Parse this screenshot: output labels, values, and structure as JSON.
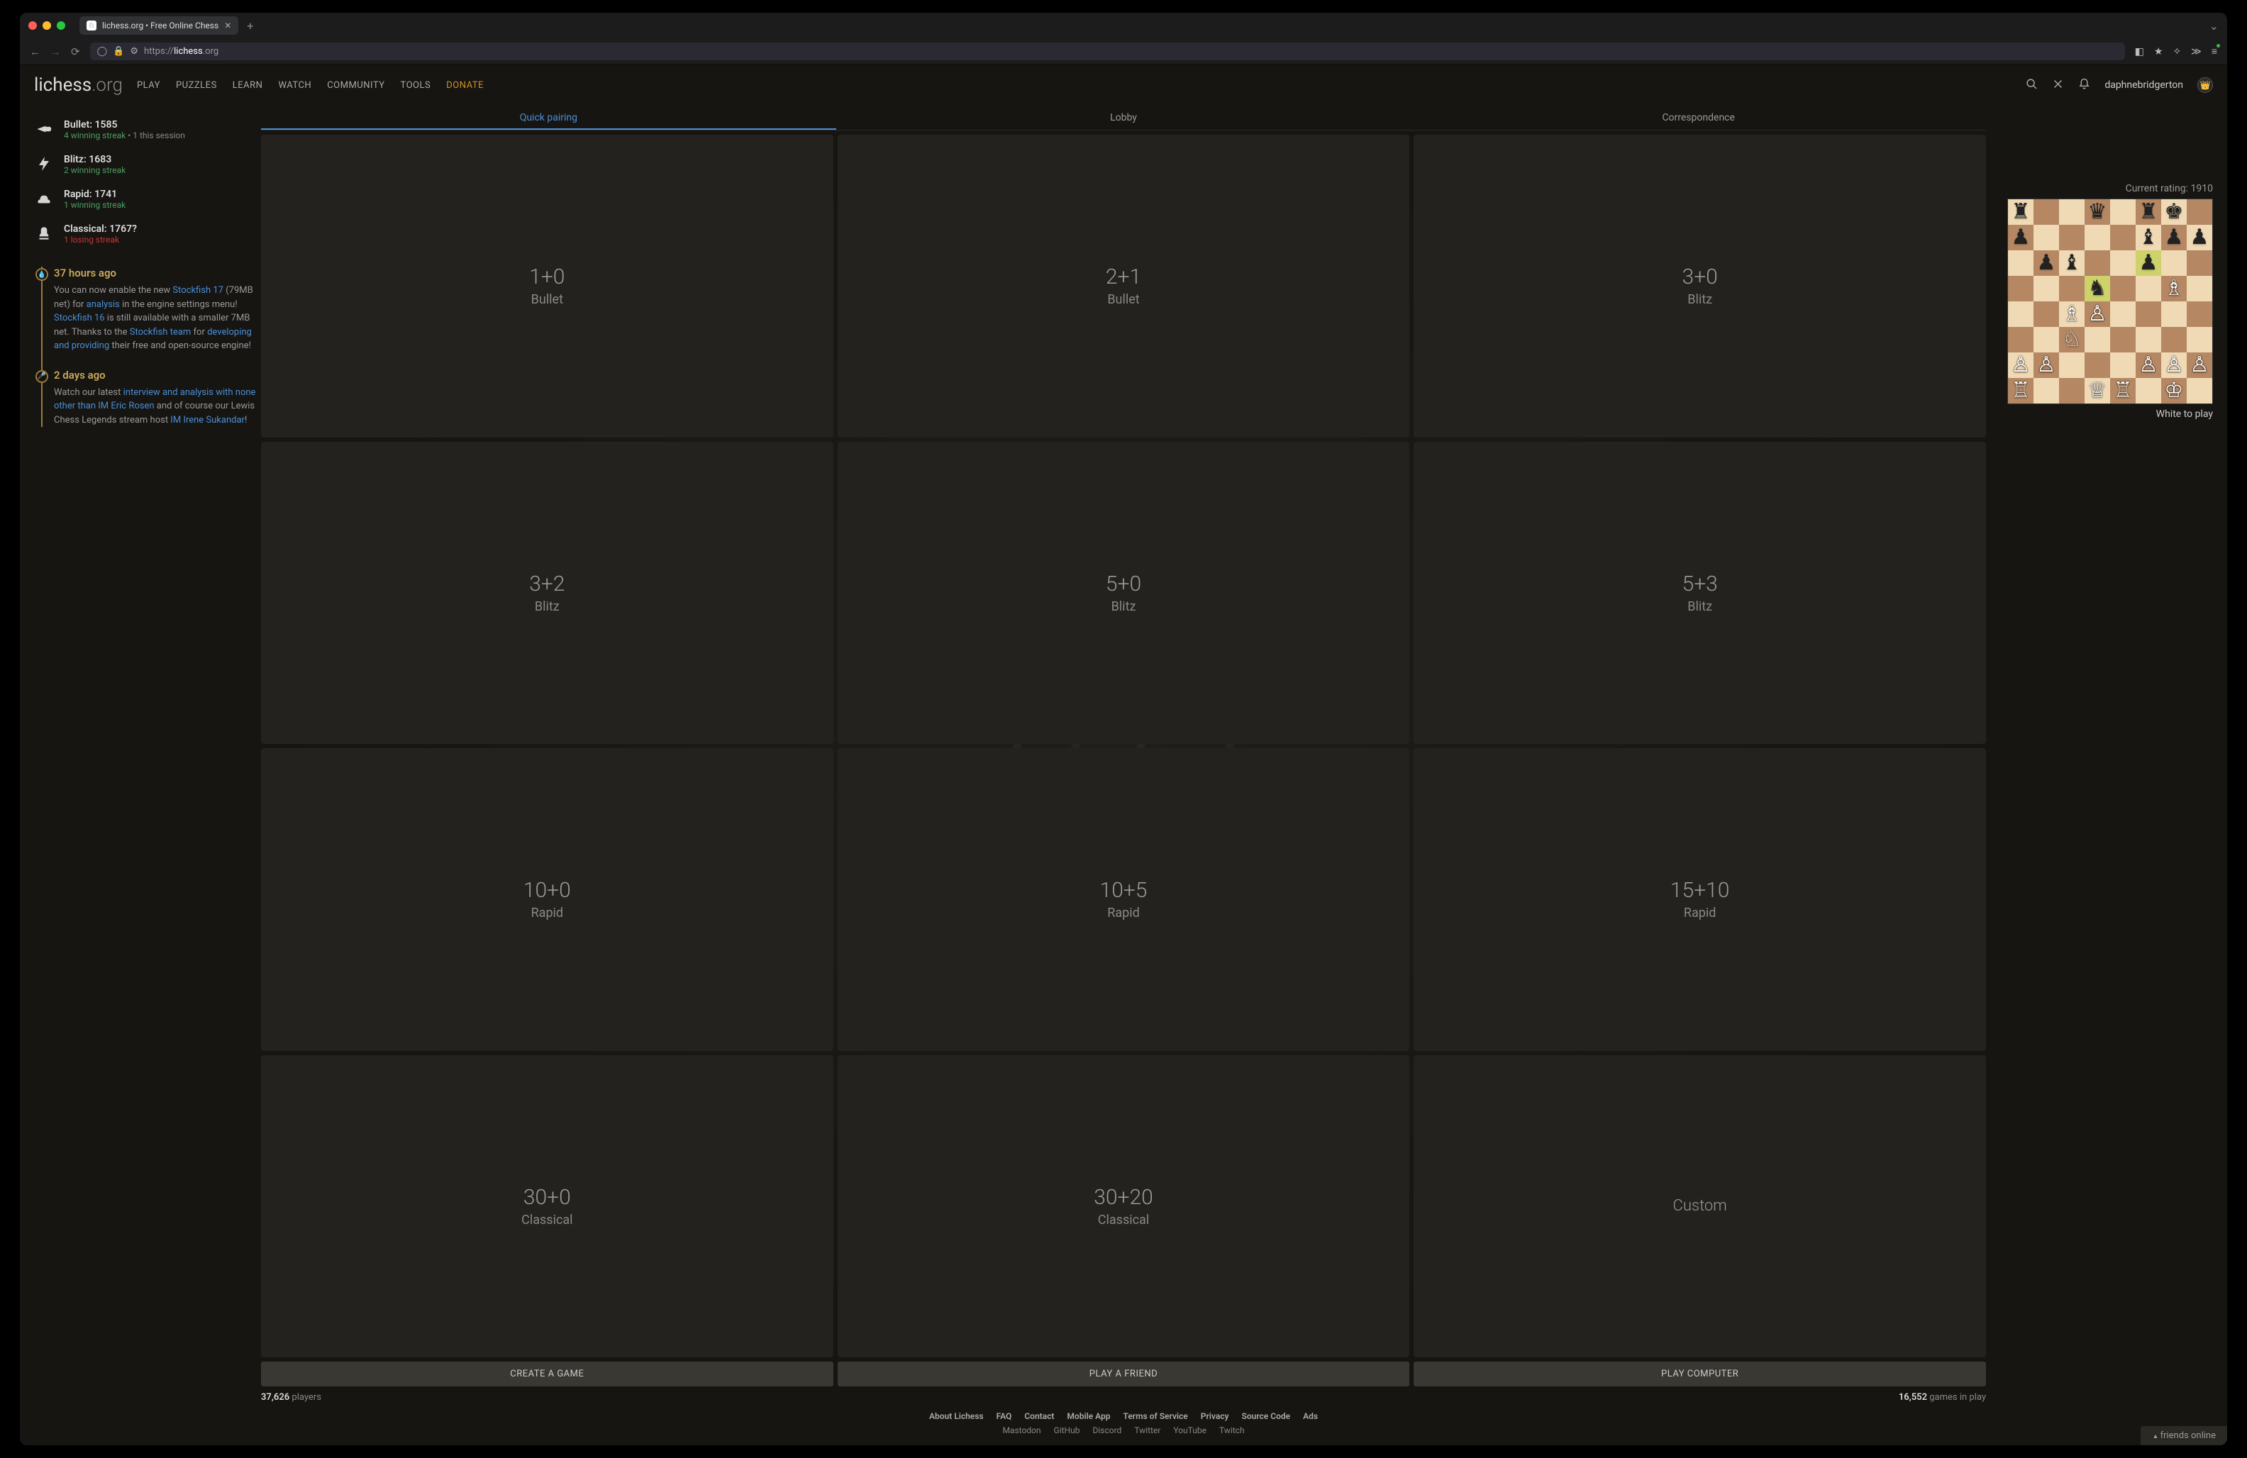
{
  "browser": {
    "tab_title": "lichess.org • Free Online Chess",
    "url_scheme": "https://",
    "url_domain": "lichess",
    "url_tld": ".org"
  },
  "header": {
    "logo_bold": "lichess",
    "logo_light": ".org",
    "nav": [
      "PLAY",
      "PUZZLES",
      "LEARN",
      "WATCH",
      "COMMUNITY",
      "TOOLS"
    ],
    "donate": "DONATE",
    "username": "daphnebridgerton"
  },
  "ratings": [
    {
      "icon": "bullet",
      "title": "Bullet: 1585",
      "streak": "4 winning streak",
      "streak_class": "win",
      "extra": " • 1 this session"
    },
    {
      "icon": "blitz",
      "title": "Blitz: 1683",
      "streak": "2 winning streak",
      "streak_class": "win",
      "extra": ""
    },
    {
      "icon": "rapid",
      "title": "Rapid: 1741",
      "streak": "1 winning streak",
      "streak_class": "win",
      "extra": ""
    },
    {
      "icon": "classical",
      "title": "Classical: 1767?",
      "streak": "1 losing streak",
      "streak_class": "lose",
      "extra": ""
    }
  ],
  "timeline": [
    {
      "time": "37 hours ago",
      "icon": "💧",
      "segments": [
        {
          "t": "You can now enable the new "
        },
        {
          "t": "Stockfish 17",
          "link": true
        },
        {
          "t": " (79MB net) for "
        },
        {
          "t": "analysis",
          "link": true
        },
        {
          "t": " in the engine settings menu! "
        },
        {
          "t": "Stockfish 16",
          "link": true
        },
        {
          "t": " is still available with a smaller 7MB net. Thanks to the "
        },
        {
          "t": "Stockfish team",
          "link": true
        },
        {
          "t": " for "
        },
        {
          "t": "developing and providing",
          "link": true
        },
        {
          "t": " their free and open-source engine!"
        }
      ]
    },
    {
      "time": "2 days ago",
      "icon": "🎤",
      "segments": [
        {
          "t": "Watch our latest "
        },
        {
          "t": "interview and analysis with none other than IM Eric Rosen",
          "link": true
        },
        {
          "t": " and of course our Lewis Chess Legends stream host "
        },
        {
          "t": "IM Irene Sukandar",
          "link": true
        },
        {
          "t": "!"
        }
      ]
    }
  ],
  "lobby": {
    "tabs": [
      "Quick pairing",
      "Lobby",
      "Correspondence"
    ],
    "active_tab": 0,
    "tiles": [
      {
        "time": "1+0",
        "type": "Bullet"
      },
      {
        "time": "2+1",
        "type": "Bullet"
      },
      {
        "time": "3+0",
        "type": "Blitz"
      },
      {
        "time": "3+2",
        "type": "Blitz"
      },
      {
        "time": "5+0",
        "type": "Blitz"
      },
      {
        "time": "5+3",
        "type": "Blitz"
      },
      {
        "time": "10+0",
        "type": "Rapid"
      },
      {
        "time": "10+5",
        "type": "Rapid"
      },
      {
        "time": "15+10",
        "type": "Rapid"
      },
      {
        "time": "30+0",
        "type": "Classical"
      },
      {
        "time": "30+20",
        "type": "Classical"
      },
      {
        "time": "Custom",
        "type": "",
        "custom": true
      }
    ],
    "actions": [
      "CREATE A GAME",
      "PLAY A FRIEND",
      "PLAY COMPUTER"
    ],
    "players_count": "37,626",
    "players_label": " players",
    "games_count": "16,552",
    "games_label": " games in play"
  },
  "puzzle": {
    "rating_label": "Current rating: ",
    "rating": "1910",
    "caption": "White to play",
    "fen_rows": [
      "r..q.rk.",
      "p....bpp",
      ".pb..p..",
      "...n..B.",
      "..BP....",
      "..N.....",
      "PP...PPP",
      "R..QR.K."
    ],
    "highlight": [
      "c4",
      "d5"
    ]
  },
  "footer": {
    "row1": [
      "About Lichess",
      "FAQ",
      "Contact",
      "Mobile App",
      "Terms of Service",
      "Privacy",
      "Source Code",
      "Ads"
    ],
    "row2": [
      "Mastodon",
      "GitHub",
      "Discord",
      "Twitter",
      "YouTube",
      "Twitch"
    ]
  },
  "friends_label": "friends online"
}
